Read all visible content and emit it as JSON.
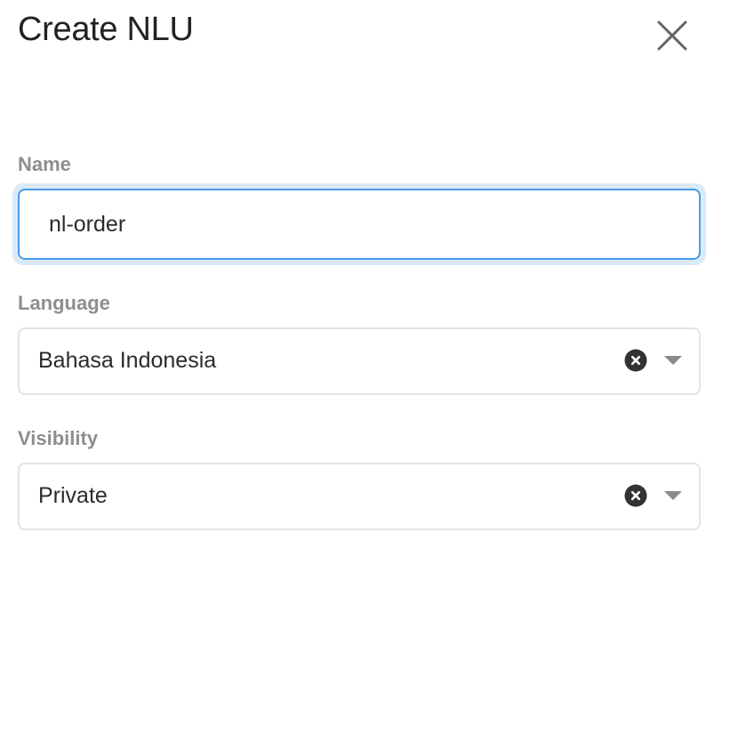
{
  "dialog": {
    "title": "Create NLU",
    "close_icon": "close-icon"
  },
  "form": {
    "name": {
      "label": "Name",
      "value": "nl-order",
      "placeholder": ""
    },
    "language": {
      "label": "Language",
      "selected": "Bahasa Indonesia",
      "clear_icon": "clear-circle-icon",
      "dropdown_icon": "caret-down-icon"
    },
    "visibility": {
      "label": "Visibility",
      "selected": "Private",
      "clear_icon": "clear-circle-icon",
      "dropdown_icon": "caret-down-icon"
    }
  },
  "colors": {
    "focus_border": "#4a9be8",
    "focus_glow": "#dbeaf9",
    "label": "#8e8e8e",
    "border": "#e3e3e3"
  }
}
